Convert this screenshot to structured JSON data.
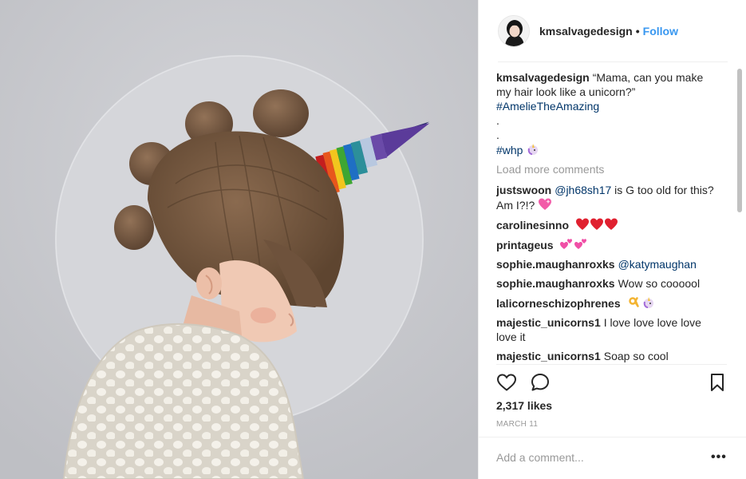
{
  "post": {
    "photo_icon": "child-with-rainbow-unicorn-horn-photo",
    "author": "kmsalvagedesign",
    "separator": "•",
    "follow_label": "Follow",
    "caption": {
      "user": "kmsalvagedesign",
      "text": "“Mama, can you make my hair look like a unicorn?”",
      "hashtag": "#AmelieTheAmazing",
      "dot1": ".",
      "dot2": ".",
      "hashtag2": "#whp"
    },
    "load_more": "Load more comments",
    "comments": [
      {
        "user": "justswoon",
        "mention": "@jh68sh17",
        "text": " is G too old for this? Am I?!? ",
        "emoji": "pink-heart"
      },
      {
        "user": "carolinesinno",
        "text": "",
        "emoji": "red-hearts-x3"
      },
      {
        "user": "printageus",
        "text": "",
        "emoji": "two-hearts-x2"
      },
      {
        "user": "sophie.maughanroxks",
        "mention": "@katymaughan",
        "text": ""
      },
      {
        "user": "sophie.maughanroxks",
        "text": "Wow so coooool"
      },
      {
        "user": "lalicorneschizophrenes",
        "text": "",
        "emoji": "ok-hand-unicorn"
      },
      {
        "user": "majestic_unicorns1",
        "text": "I love love love love love it"
      },
      {
        "user": "majestic_unicorns1",
        "text": "Soap so cool"
      }
    ],
    "likes": "2,317 likes",
    "date": "MARCH 11",
    "add_comment_placeholder": "Add a comment...",
    "more_label": "•••",
    "icons": {
      "like": "heart-outline-icon",
      "comment": "comment-bubble-icon",
      "save": "bookmark-icon",
      "more": "more-options-icon"
    }
  }
}
